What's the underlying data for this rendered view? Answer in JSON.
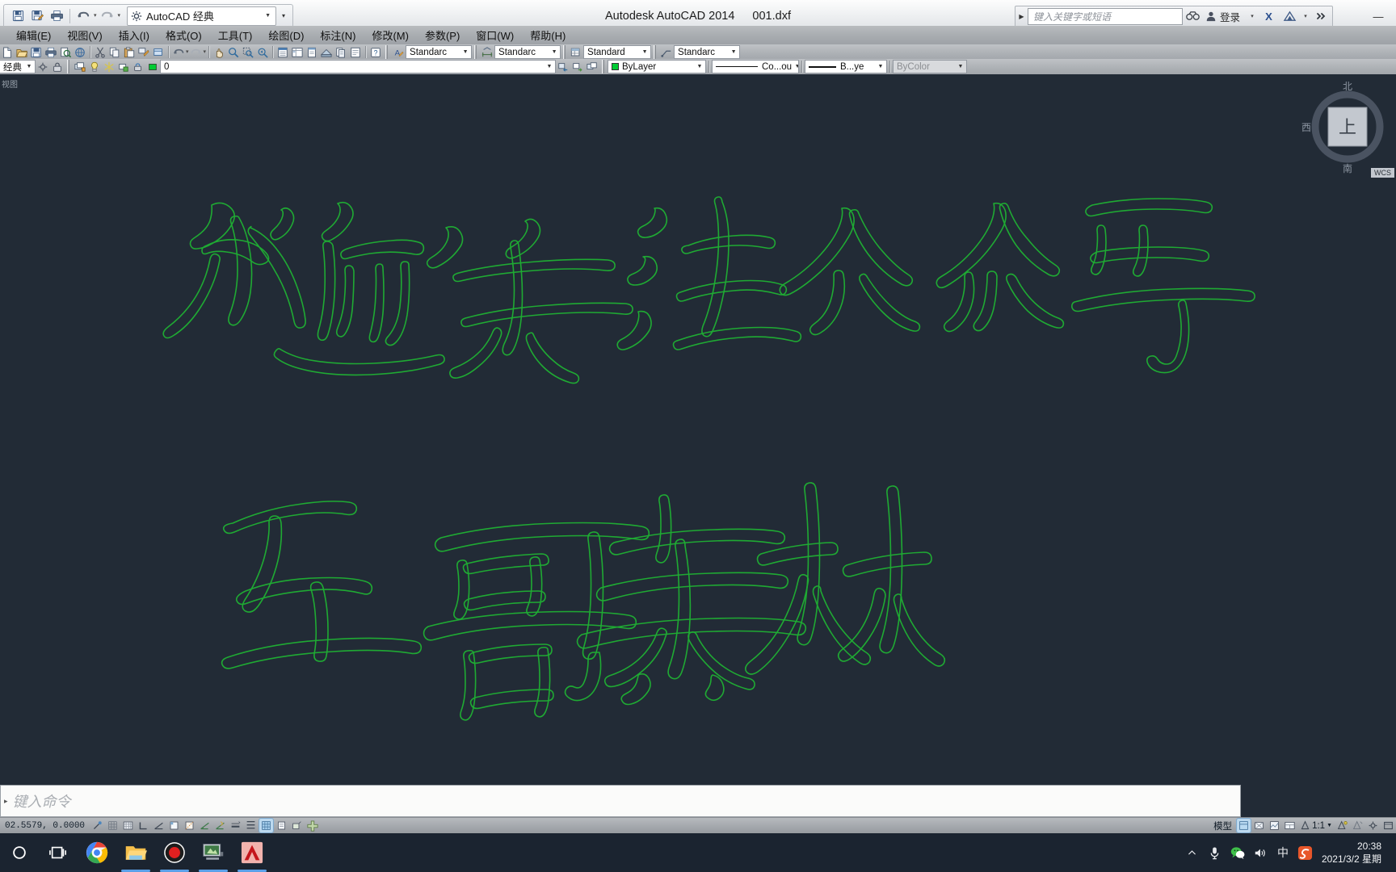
{
  "window": {
    "app_title": "Autodesk AutoCAD 2014",
    "file_name": "001.dxf",
    "minimize_label": "—"
  },
  "quick_access": {
    "workspace_value": "AutoCAD 经典",
    "buttons": [
      {
        "name": "save-button",
        "label": "保存"
      },
      {
        "name": "save-as-button",
        "label": "另存为"
      },
      {
        "name": "plot-button",
        "label": "打印"
      },
      {
        "name": "undo-button",
        "label": "放弃"
      },
      {
        "name": "redo-button",
        "label": "重做"
      }
    ],
    "more_label": "▾"
  },
  "infocenter": {
    "search_placeholder": "键入关键字或短语",
    "search_value": "",
    "signin_label": "登录",
    "exchange_label": "X",
    "autodesk_label": "A"
  },
  "menubar": {
    "items": [
      {
        "name": "menu-edit",
        "label": "编辑(E)"
      },
      {
        "name": "menu-view",
        "label": "视图(V)"
      },
      {
        "name": "menu-insert",
        "label": "插入(I)"
      },
      {
        "name": "menu-format",
        "label": "格式(O)"
      },
      {
        "name": "menu-tools",
        "label": "工具(T)"
      },
      {
        "name": "menu-draw",
        "label": "绘图(D)"
      },
      {
        "name": "menu-dim",
        "label": "标注(N)"
      },
      {
        "name": "menu-modify",
        "label": "修改(M)"
      },
      {
        "name": "menu-params",
        "label": "参数(P)"
      },
      {
        "name": "menu-window",
        "label": "窗口(W)"
      },
      {
        "name": "menu-help",
        "label": "帮助(H)"
      }
    ]
  },
  "toolbar_styles": {
    "text_style": "Standarc",
    "dim_style": "Standarc",
    "table_style": "Standard",
    "mleader_style": "Standarc"
  },
  "layer_toolbar": {
    "workspace_tail": "经典",
    "layer_name": "0",
    "layer_color": "#00cc33",
    "color_value": "ByLayer",
    "linetype_value": "Co...ou",
    "lineweight_value": "B...ye",
    "plotstyle_value": "ByColor"
  },
  "canvas": {
    "tab_label": "视图",
    "background_color": "#222b36",
    "line_color": "#1faa33",
    "drawing_text_line1": "欢迎关注公众号",
    "drawing_text_line2": "五哥素材"
  },
  "viewcube": {
    "top_label": "上",
    "north_label": "北",
    "west_label": "西",
    "south_label": "南",
    "wcs_label": "WCS"
  },
  "command_line": {
    "prompt_caret": "▸",
    "placeholder": "键入命令",
    "value": ""
  },
  "status_bar": {
    "coordinates": "02.5579,  0.0000",
    "space_label": "模型",
    "scale_label": "1:1",
    "toggles": [
      {
        "name": "status-snap",
        "label": "捕捉",
        "on": false
      },
      {
        "name": "status-grid",
        "label": "栅格",
        "on": false
      },
      {
        "name": "status-grid-display",
        "label": "栅格显示",
        "on": false
      },
      {
        "name": "status-ortho",
        "label": "正交",
        "on": false
      },
      {
        "name": "status-polar",
        "label": "极轴",
        "on": false
      },
      {
        "name": "status-osnap",
        "label": "对象捕捉",
        "on": false
      },
      {
        "name": "status-otrack",
        "label": "对象追踪",
        "on": false
      },
      {
        "name": "status-ucsicon",
        "label": "允许/禁止UCS",
        "on": false
      },
      {
        "name": "status-dyn",
        "label": "动态输入",
        "on": false
      },
      {
        "name": "status-lwt",
        "label": "线宽",
        "on": true
      },
      {
        "name": "status-transparency",
        "label": "透明度",
        "on": false
      },
      {
        "name": "status-selcycle",
        "label": "选择循环",
        "on": false
      },
      {
        "name": "status-annomon",
        "label": "注释监视器",
        "on": false
      }
    ]
  },
  "taskbar": {
    "apps": [
      {
        "name": "taskbar-search",
        "label": "搜索",
        "active": false
      },
      {
        "name": "taskbar-task-view",
        "label": "任务视图",
        "active": false
      },
      {
        "name": "taskbar-chrome",
        "label": "Chrome",
        "active": false
      },
      {
        "name": "taskbar-file-explorer",
        "label": "文件资源管理器",
        "active": true
      },
      {
        "name": "taskbar-bandicam",
        "label": "Bandicam",
        "active": true
      },
      {
        "name": "taskbar-media-app",
        "label": "播放器",
        "active": true
      },
      {
        "name": "taskbar-autocad",
        "label": "AutoCAD",
        "active": true
      }
    ],
    "tray": [
      {
        "name": "tray-show-hidden-icon",
        "label": "∧"
      },
      {
        "name": "tray-microphone-icon",
        "label": "🎙"
      },
      {
        "name": "tray-wechat-icon",
        "label": "W"
      },
      {
        "name": "tray-volume-icon",
        "label": "🔊"
      },
      {
        "name": "tray-ime-icon",
        "label": "中"
      },
      {
        "name": "tray-sogou-icon",
        "label": "S"
      }
    ],
    "time": "20:38",
    "date": "2021/3/2 星期"
  }
}
